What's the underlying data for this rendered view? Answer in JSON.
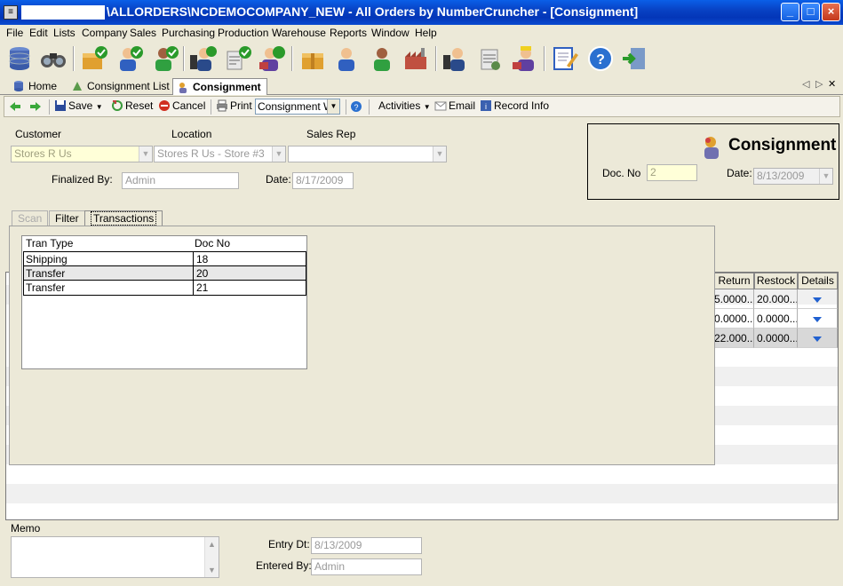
{
  "window": {
    "title": "\\ALLORDERS\\NCDEMOCOMPANY_NEW - All Orders by NumberCruncher - [Consignment]",
    "minimize": "_",
    "maximize": "□",
    "close": "×"
  },
  "menu": [
    "File",
    "Edit",
    "Lists",
    "Company",
    "Sales",
    "Purchasing",
    "Production",
    "Warehouse",
    "Reports",
    "Window",
    "Help"
  ],
  "doc_tabs": {
    "home": "Home",
    "consignment_list": "Consignment List",
    "consignment": "Consignment",
    "nav_left": "◁",
    "nav_right": "▷",
    "nav_close": "✕"
  },
  "actions": {
    "save": "Save",
    "reset": "Reset",
    "cancel": "Cancel",
    "print": "Print",
    "print_option": "Consignment W",
    "activities": "Activities",
    "email": "Email",
    "record_info": "Record Info"
  },
  "form": {
    "customer_label": "Customer",
    "customer_value": "Stores R Us",
    "location_label": "Location",
    "location_value": "Stores R Us - Store #3",
    "sales_rep_label": "Sales Rep",
    "sales_rep_value": "",
    "finalized_by_label": "Finalized By:",
    "finalized_by_value": "Admin",
    "date_label": "Date:",
    "date_value": "8/17/2009"
  },
  "header": {
    "title": "Consignment",
    "doc_no_label": "Doc. No",
    "doc_no_value": "2",
    "date_label": "Date:",
    "date_value": "8/13/2009"
  },
  "inner_tabs": {
    "scan": "Scan",
    "filter": "Filter",
    "transactions": "Transactions"
  },
  "transactions": {
    "columns": [
      "Tran Type",
      "Doc No"
    ],
    "rows": [
      {
        "tran_type": "Shipping",
        "doc_no": "18"
      },
      {
        "tran_type": "Transfer",
        "doc_no": "20"
      },
      {
        "tran_type": "Transfer",
        "doc_no": "21"
      }
    ]
  },
  "grid": {
    "columns": [
      "Return",
      "Restock",
      "Details"
    ],
    "rows": [
      {
        "return": "5.0000...",
        "restock": "20.000..."
      },
      {
        "return": "0.0000...",
        "restock": "0.0000..."
      },
      {
        "return": "22.000...",
        "restock": "0.0000..."
      }
    ]
  },
  "bottom": {
    "memo_label": "Memo",
    "entry_dt_label": "Entry Dt:",
    "entry_dt_value": "8/13/2009",
    "entered_by_label": "Entered By:",
    "entered_by_value": "Admin"
  }
}
